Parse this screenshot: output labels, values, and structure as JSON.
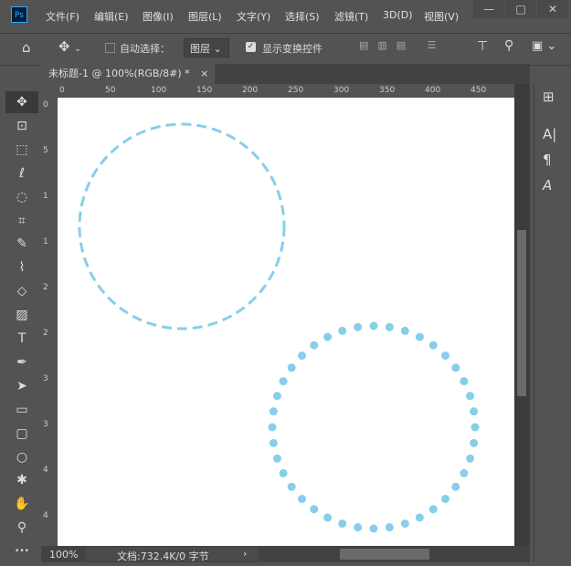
{
  "app": {
    "logo": "Ps"
  },
  "menu": [
    "文件(F)",
    "编辑(E)",
    "图像(I)",
    "图层(L)",
    "文字(Y)",
    "选择(S)",
    "滤镜(T)",
    "3D(D)",
    "视图(V)"
  ],
  "window_controls": {
    "minimize": "—",
    "maximize": "□",
    "close": "✕"
  },
  "options": {
    "auto_select_label": "自动选择：",
    "auto_select_checked": false,
    "target_value": "图层",
    "show_transform_label": "显示变换控件",
    "show_transform_checked": true
  },
  "document": {
    "tab_title": "未标题-1 @ 100%(RGB/8#) *",
    "close": "×"
  },
  "ruler": {
    "h_ticks": [
      "0",
      "50",
      "100",
      "150",
      "200",
      "250",
      "300",
      "350",
      "400",
      "450"
    ],
    "v_ticks": [
      "0",
      "5",
      "1",
      "1",
      "2",
      "2",
      "3",
      "3",
      "4",
      "4"
    ]
  },
  "status": {
    "zoom": "100%",
    "doc_info": "文档:732.4K/0 字节",
    "arrow": "›"
  },
  "tools": [
    "move-icon",
    "artboard-icon",
    "marquee-icon",
    "lasso-icon",
    "quick-select-icon",
    "crop-icon",
    "eyedropper-icon",
    "brush-icon",
    "eraser-icon",
    "gradient-icon",
    "type-icon",
    "pen-icon",
    "path-select-icon",
    "rectangle-icon",
    "rounded-rect-icon",
    "ellipse-icon",
    "custom-shape-icon",
    "hand-icon",
    "zoom-icon",
    "more-icon"
  ],
  "colors": {
    "stroke": "#87ceeb",
    "canvas": "#ffffff",
    "ui": "#535353"
  }
}
